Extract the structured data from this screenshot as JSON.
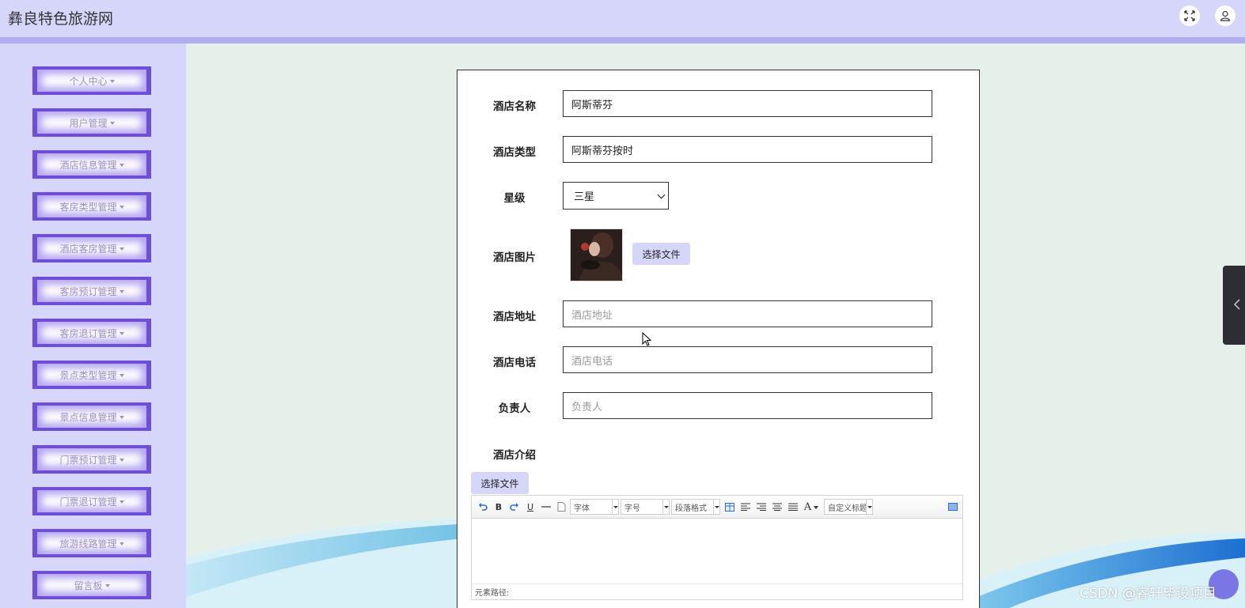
{
  "header": {
    "title": "彝良特色旅游网",
    "fullscreen_icon": "expand-icon",
    "user_icon": "user-icon"
  },
  "sidebar": {
    "items": [
      {
        "label": "个人中心"
      },
      {
        "label": "用户管理"
      },
      {
        "label": "酒店信息管理"
      },
      {
        "label": "客房类型管理"
      },
      {
        "label": "酒店客房管理"
      },
      {
        "label": "客房预订管理"
      },
      {
        "label": "客房退订管理"
      },
      {
        "label": "景点类型管理"
      },
      {
        "label": "景点信息管理"
      },
      {
        "label": "门票预订管理"
      },
      {
        "label": "门票退订管理"
      },
      {
        "label": "旅游线路管理"
      },
      {
        "label": "留言板"
      }
    ]
  },
  "form": {
    "hotel_name": {
      "label": "酒店名称",
      "value": "阿斯蒂芬"
    },
    "hotel_type": {
      "label": "酒店类型",
      "value": "阿斯蒂芬按时"
    },
    "star": {
      "label": "星级",
      "value": "三星"
    },
    "image": {
      "label": "酒店图片",
      "button": "选择文件"
    },
    "address": {
      "label": "酒店地址",
      "value": "",
      "placeholder": "酒店地址"
    },
    "phone": {
      "label": "酒店电话",
      "value": "",
      "placeholder": "酒店电话"
    },
    "manager": {
      "label": "负责人",
      "value": "",
      "placeholder": "负责人"
    },
    "intro": {
      "label": "酒店介绍",
      "button": "选择文件"
    }
  },
  "editor": {
    "font_family": "字体",
    "font_size": "字号",
    "paragraph": "段落格式",
    "custom_title": "自定义标题",
    "font_color_glyph": "A",
    "bold_glyph": "B",
    "underline_glyph": "U",
    "status": "元素路径:"
  },
  "watermark": "CSDN @睿轩毕设项目",
  "colors": {
    "header_bg": "#d6d6fb",
    "menu_frame": "#6f4fd9",
    "main_bg": "#e6f0ea"
  }
}
